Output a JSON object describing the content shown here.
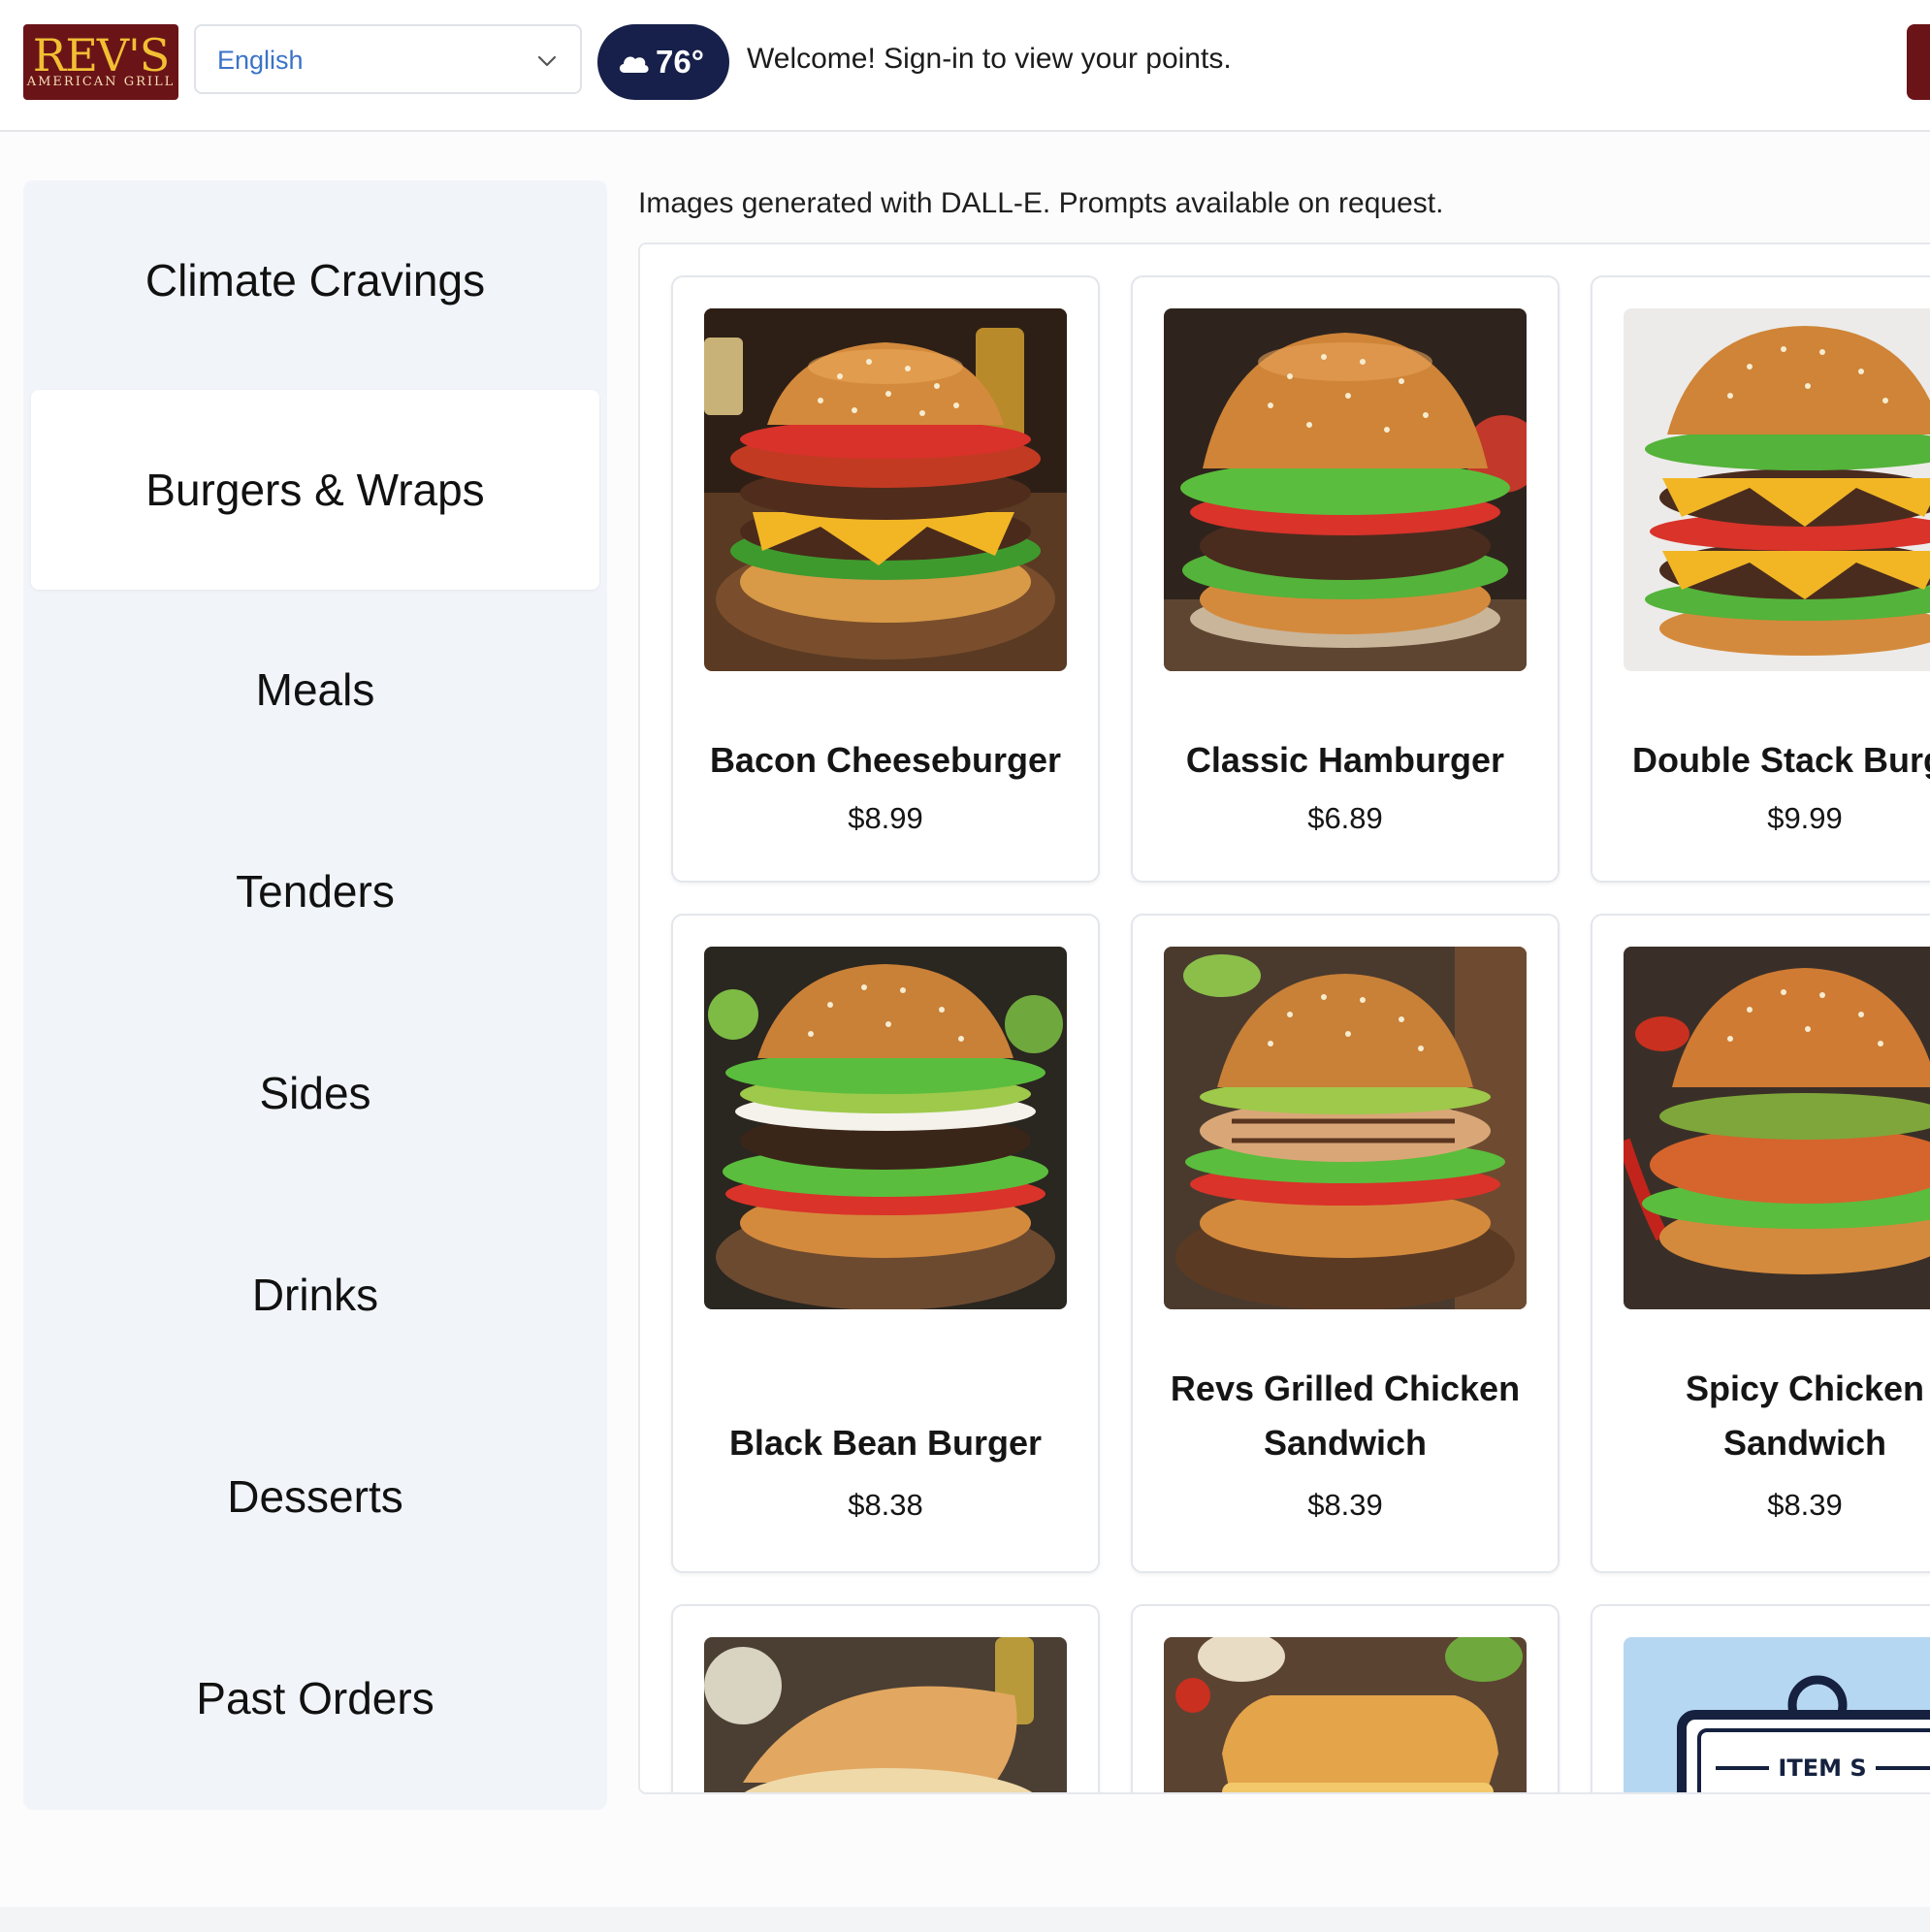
{
  "header": {
    "logo_text": "REV'S",
    "logo_subtext": "AMERICAN GRILL",
    "language": "English",
    "weather_temp": "76°",
    "welcome_text": "Welcome! Sign-in to view your points."
  },
  "sidebar": {
    "items": [
      {
        "label": "Climate Cravings",
        "active": false
      },
      {
        "label": "Burgers & Wraps",
        "active": true
      },
      {
        "label": "Meals",
        "active": false
      },
      {
        "label": "Tenders",
        "active": false
      },
      {
        "label": "Sides",
        "active": false
      },
      {
        "label": "Drinks",
        "active": false
      },
      {
        "label": "Desserts",
        "active": false
      },
      {
        "label": "Past Orders",
        "active": false
      }
    ]
  },
  "main": {
    "note": "Images generated with DALL-E. Prompts available on request.",
    "items": [
      {
        "name": "Bacon Cheeseburger",
        "price": "$8.99"
      },
      {
        "name": "Classic Hamburger",
        "price": "$6.89"
      },
      {
        "name": "Double Stack Burger",
        "price": "$9.99"
      },
      {
        "name": "Black Bean Burger",
        "price": "$8.38"
      },
      {
        "name": "Revs Grilled Chicken Sandwich",
        "price": "$8.39"
      },
      {
        "name": "Spicy Chicken Sandwich",
        "price": "$8.39"
      },
      {
        "name": "",
        "price": ""
      },
      {
        "name": "",
        "price": ""
      },
      {
        "name": "",
        "price": ""
      }
    ],
    "coming_soon_badge": "ITEM S"
  },
  "colors": {
    "brand_maroon": "#6b1418",
    "brand_gold": "#f2bf33",
    "weather_navy": "#17204a",
    "sidebar_bg": "#f1f4f9",
    "link_blue": "#3b73c7"
  }
}
